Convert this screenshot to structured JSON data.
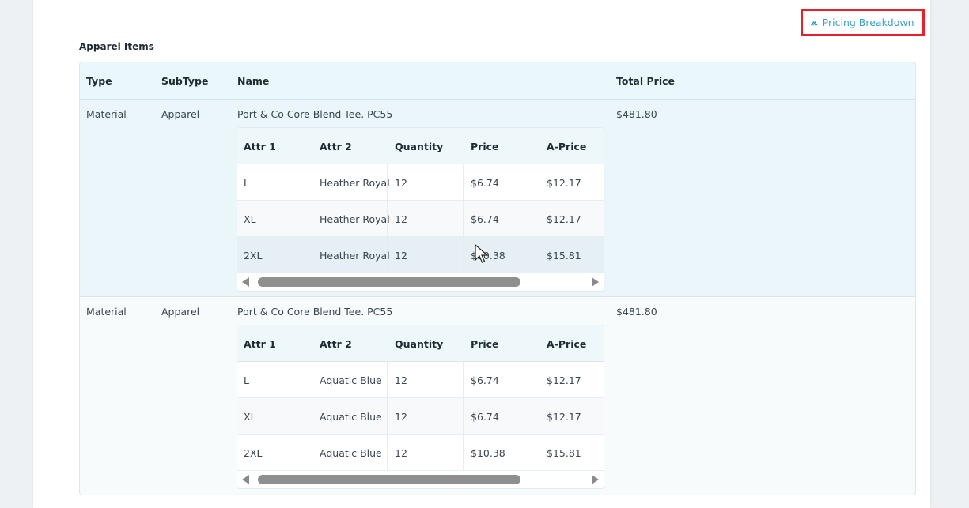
{
  "pricing_toggle": {
    "icon": "collapse-chevron-icon",
    "label": "Pricing Breakdown"
  },
  "section_title": "Apparel Items",
  "outer_columns": {
    "type": "Type",
    "subtype": "SubType",
    "name": "Name",
    "total": "Total Price"
  },
  "inner_columns": {
    "attr1": "Attr 1",
    "attr2": "Attr 2",
    "quantity": "Quantity",
    "price": "Price",
    "aprice": "A-Price"
  },
  "items": [
    {
      "type": "Material",
      "subtype": "Apparel",
      "name": "Port & Co Core Blend Tee. PC55",
      "total": "$481.80",
      "rows": [
        {
          "attr1": "L",
          "attr2": "Heather Royal",
          "quantity": "12",
          "price": "$6.74",
          "aprice": "$12.17"
        },
        {
          "attr1": "XL",
          "attr2": "Heather Royal",
          "quantity": "12",
          "price": "$6.74",
          "aprice": "$12.17"
        },
        {
          "attr1": "2XL",
          "attr2": "Heather Royal",
          "quantity": "12",
          "price": "$10.38",
          "aprice": "$15.81"
        }
      ]
    },
    {
      "type": "Material",
      "subtype": "Apparel",
      "name": "Port & Co Core Blend Tee. PC55",
      "total": "$481.80",
      "rows": [
        {
          "attr1": "L",
          "attr2": "Aquatic Blue",
          "quantity": "12",
          "price": "$6.74",
          "aprice": "$12.17"
        },
        {
          "attr1": "XL",
          "attr2": "Aquatic Blue",
          "quantity": "12",
          "price": "$6.74",
          "aprice": "$12.17"
        },
        {
          "attr1": "2XL",
          "attr2": "Aquatic Blue",
          "quantity": "12",
          "price": "$10.38",
          "aprice": "$15.81"
        }
      ]
    }
  ],
  "colors": {
    "highlight_border": "#e8202a",
    "link": "#3aa0c8"
  }
}
